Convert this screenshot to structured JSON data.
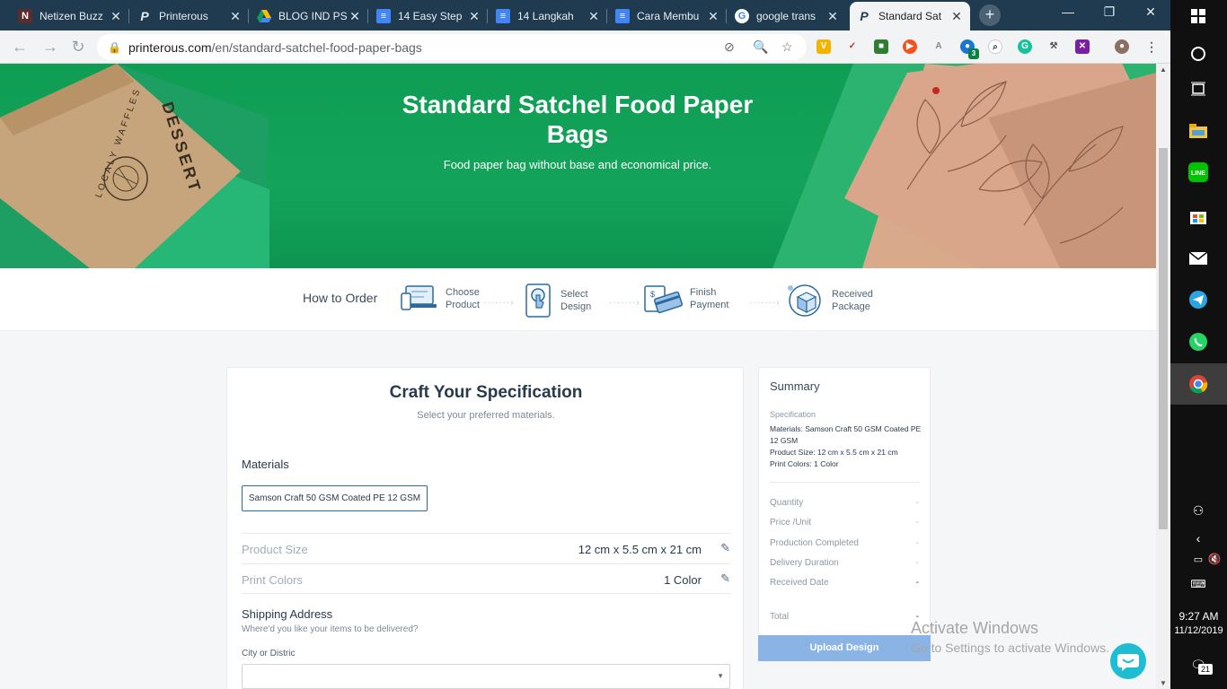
{
  "browser": {
    "tabs": [
      {
        "title": "Netizen Buzz",
        "favicon": "netizen-icon",
        "color": "#5a2d2d",
        "active": false
      },
      {
        "title": "Printerous",
        "favicon": "printerous-icon",
        "color": "#203b4f",
        "active": false
      },
      {
        "title": "BLOG IND PS",
        "favicon": "google-drive-icon",
        "color": "#fbbc04",
        "active": false
      },
      {
        "title": "14 Easy Step",
        "favicon": "google-docs-icon",
        "color": "#4285f4",
        "active": false
      },
      {
        "title": "14 Langkah",
        "favicon": "google-docs-icon",
        "color": "#4285f4",
        "active": false
      },
      {
        "title": "Cara Membu",
        "favicon": "google-docs-icon",
        "color": "#4285f4",
        "active": false
      },
      {
        "title": "google trans",
        "favicon": "google-icon",
        "color": "#ffffff",
        "active": false
      },
      {
        "title": "Standard Sat",
        "favicon": "printerous-icon",
        "color": "#203b4f",
        "active": true
      }
    ],
    "new_tab": "+",
    "window_controls": {
      "minimize": "—",
      "restore": "❐",
      "close": "✕"
    },
    "url_host": "printerous.com",
    "url_path": "/en/standard-satchel-food-paper-bags",
    "extension_badge": "3"
  },
  "hero": {
    "title": "Standard Satchel Food Paper Bags",
    "subtitle": "Food paper bag without base and economical price.",
    "left_bag_text": "DESSERT",
    "left_bag_brand": "LOCALY WAFFLES"
  },
  "how_to_order": {
    "label": "How to Order",
    "steps": [
      {
        "label": "Choose Product",
        "icon": "laptop-phone-icon"
      },
      {
        "label": "Select Design",
        "icon": "hand-tap-icon"
      },
      {
        "label": "Finish Payment",
        "icon": "credit-card-icon"
      },
      {
        "label": "Received Package",
        "icon": "package-icon"
      }
    ],
    "arrow": "·······›"
  },
  "spec": {
    "title": "Craft Your Specification",
    "subtitle": "Select your preferred materials.",
    "materials_heading": "Materials",
    "material_option": "Samson Craft 50 GSM Coated PE 12 GSM",
    "rows": [
      {
        "label": "Product Size",
        "value": "12 cm x 5.5 cm x 21 cm"
      },
      {
        "label": "Print Colors",
        "value": "1 Color"
      }
    ],
    "shipping_heading": "Shipping Address",
    "shipping_sub": "Where'd you like your items to be delivered?",
    "city_label": "City or Distric",
    "city_value": ""
  },
  "summary": {
    "title": "Summary",
    "spec_label": "Specification",
    "spec_lines": [
      "Materials: Samson Craft 50 GSM Coated PE 12 GSM",
      "Product Size: 12 cm x 5.5 cm x 21 cm",
      "Print Colors: 1 Color"
    ],
    "rows": [
      {
        "label": "Quantity",
        "value": "-"
      },
      {
        "label": "Price /Unit",
        "value": "-"
      },
      {
        "label": "Production Completed",
        "value": "-"
      },
      {
        "label": "Delivery Duration",
        "value": "-"
      },
      {
        "label": "Received Date",
        "value": "-"
      },
      {
        "label": "Total",
        "value": "-"
      }
    ],
    "upload_button": "Upload Design"
  },
  "watermark": {
    "line1": "Activate Windows",
    "line2": "Go to Settings to activate Windows."
  },
  "taskbar": {
    "time": "9:27 AM",
    "date": "11/12/2019",
    "notifications": "21"
  },
  "colors": {
    "hero_green": "#14a35a",
    "brand_blue": "#2b6a9e",
    "upload_button": "#8bb4e6",
    "chat_bubble": "#1ebdd2"
  }
}
